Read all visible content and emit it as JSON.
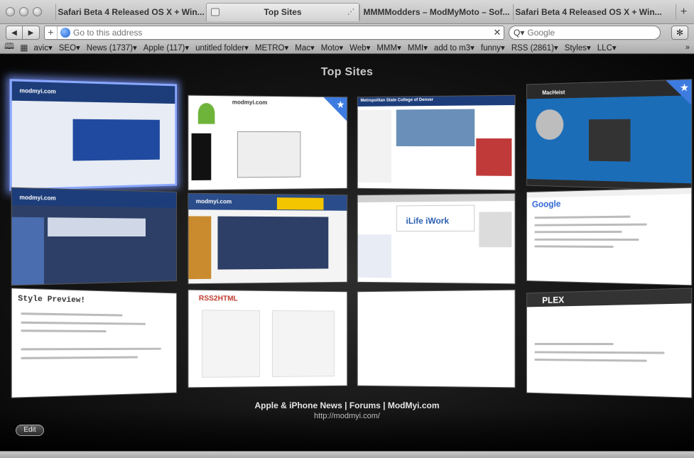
{
  "tabs": [
    {
      "label": "Safari Beta 4 Released OS X + Win...",
      "active": false
    },
    {
      "label": "Top Sites",
      "active": true
    },
    {
      "label": "MMMModders – ModMyMoto – Sof...",
      "active": false
    },
    {
      "label": "Safari Beta 4 Released OS X + Win...",
      "active": false
    }
  ],
  "new_tab_label": "+",
  "toolbar": {
    "address_placeholder": "Go to this address",
    "search_placeholder": "Google",
    "search_engine_label": "Q▾"
  },
  "bookmarks": [
    "avic▾",
    "SEO▾",
    "News (1737)▾",
    "Apple (117)▾",
    "untitled folder▾",
    "METRO▾",
    "Mac▾",
    "Moto▾",
    "Web▾",
    "MMM▾",
    "MMI▾",
    "add to m3▾",
    "funny▾",
    "RSS (2861)▾",
    "Styles▾",
    "LLC▾"
  ],
  "bookmarks_more": "»",
  "top_sites": {
    "title": "Top Sites",
    "thumbnails": [
      {
        "label": "modmyi.com",
        "selected": true,
        "starred": false,
        "color": "#1d3d7a"
      },
      {
        "label": "modmyi.com",
        "selected": false,
        "starred": true,
        "color": "#2c7a2a"
      },
      {
        "label": "Metropolitan State College of Denver",
        "selected": false,
        "starred": false,
        "color": "#1d3d7a"
      },
      {
        "label": "MacHeist",
        "selected": false,
        "starred": true,
        "color": "#2a2a2a"
      },
      {
        "label": "modmyi.com",
        "selected": false,
        "starred": false,
        "color": "#1d3d7a"
      },
      {
        "label": "modmyi.com",
        "selected": false,
        "starred": false,
        "color": "#2a4c8a"
      },
      {
        "label": "iLife iWork",
        "selected": false,
        "starred": false,
        "color": "#d0d0d0"
      },
      {
        "label": "Google",
        "selected": false,
        "starred": false,
        "color": "#ffffff"
      },
      {
        "label": "Style Preview!",
        "selected": false,
        "starred": false,
        "color": "#ffffff"
      },
      {
        "label": "RSS2HTML",
        "selected": false,
        "starred": false,
        "color": "#ffffff"
      },
      {
        "label": "",
        "selected": false,
        "starred": false,
        "color": "#ffffff"
      },
      {
        "label": "PLEX",
        "selected": false,
        "starred": false,
        "color": "#333333"
      }
    ],
    "caption": "Apple & iPhone News | Forums | ModMyi.com",
    "caption_url": "http://modmyi.com/",
    "edit_label": "Edit"
  }
}
